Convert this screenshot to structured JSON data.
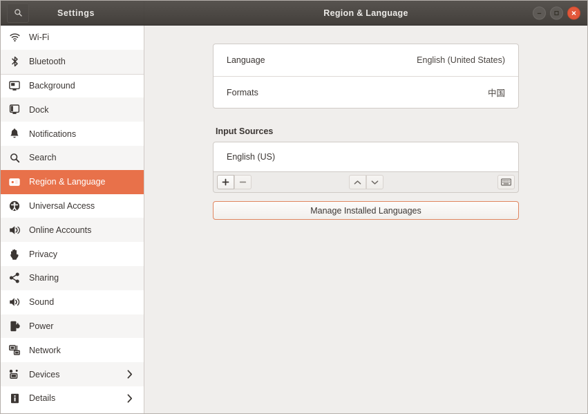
{
  "window": {
    "app_title": "Settings",
    "page_title": "Region & Language",
    "search_icon": "search-icon",
    "controls": {
      "minimize": "minimize-icon",
      "maximize": "maximize-icon",
      "close": "close-icon"
    }
  },
  "colors": {
    "accent": "#e8714a",
    "titlebar": "#4a4642",
    "close_button": "#e2573a",
    "panel_bg": "#f0eeec",
    "card_bg": "#ffffff"
  },
  "sidebar": {
    "items": [
      {
        "label": "Wi-Fi",
        "icon": "wifi-icon",
        "selected": false,
        "chevron": false
      },
      {
        "label": "Bluetooth",
        "icon": "bluetooth-icon",
        "selected": false,
        "chevron": false
      },
      {
        "label": "Background",
        "icon": "background-monitor-icon",
        "selected": false,
        "chevron": false
      },
      {
        "label": "Dock",
        "icon": "dock-icon",
        "selected": false,
        "chevron": false
      },
      {
        "label": "Notifications",
        "icon": "bell-icon",
        "selected": false,
        "chevron": false
      },
      {
        "label": "Search",
        "icon": "search-icon",
        "selected": false,
        "chevron": false
      },
      {
        "label": "Region & Language",
        "icon": "region-language-icon",
        "selected": true,
        "chevron": false
      },
      {
        "label": "Universal Access",
        "icon": "universal-access-icon",
        "selected": false,
        "chevron": false
      },
      {
        "label": "Online Accounts",
        "icon": "online-accounts-icon",
        "selected": false,
        "chevron": false
      },
      {
        "label": "Privacy",
        "icon": "privacy-hand-icon",
        "selected": false,
        "chevron": false
      },
      {
        "label": "Sharing",
        "icon": "sharing-icon",
        "selected": false,
        "chevron": false
      },
      {
        "label": "Sound",
        "icon": "sound-icon",
        "selected": false,
        "chevron": false
      },
      {
        "label": "Power",
        "icon": "power-icon",
        "selected": false,
        "chevron": false
      },
      {
        "label": "Network",
        "icon": "network-icon",
        "selected": false,
        "chevron": false
      },
      {
        "label": "Devices",
        "icon": "devices-icon",
        "selected": false,
        "chevron": true
      },
      {
        "label": "Details",
        "icon": "details-info-icon",
        "selected": false,
        "chevron": true
      }
    ]
  },
  "main": {
    "settings_rows": [
      {
        "label": "Language",
        "value": "English (United States)"
      },
      {
        "label": "Formats",
        "value": "中国"
      }
    ],
    "input_sources": {
      "section_title": "Input Sources",
      "items": [
        {
          "label": "English (US)"
        }
      ],
      "toolbar": {
        "add_label": "+",
        "remove_label": "−",
        "move_up_icon": "chevron-up-icon",
        "move_down_icon": "chevron-down-icon",
        "keyboard_preview_icon": "keyboard-icon"
      }
    },
    "manage_button_label": "Manage Installed Languages"
  }
}
